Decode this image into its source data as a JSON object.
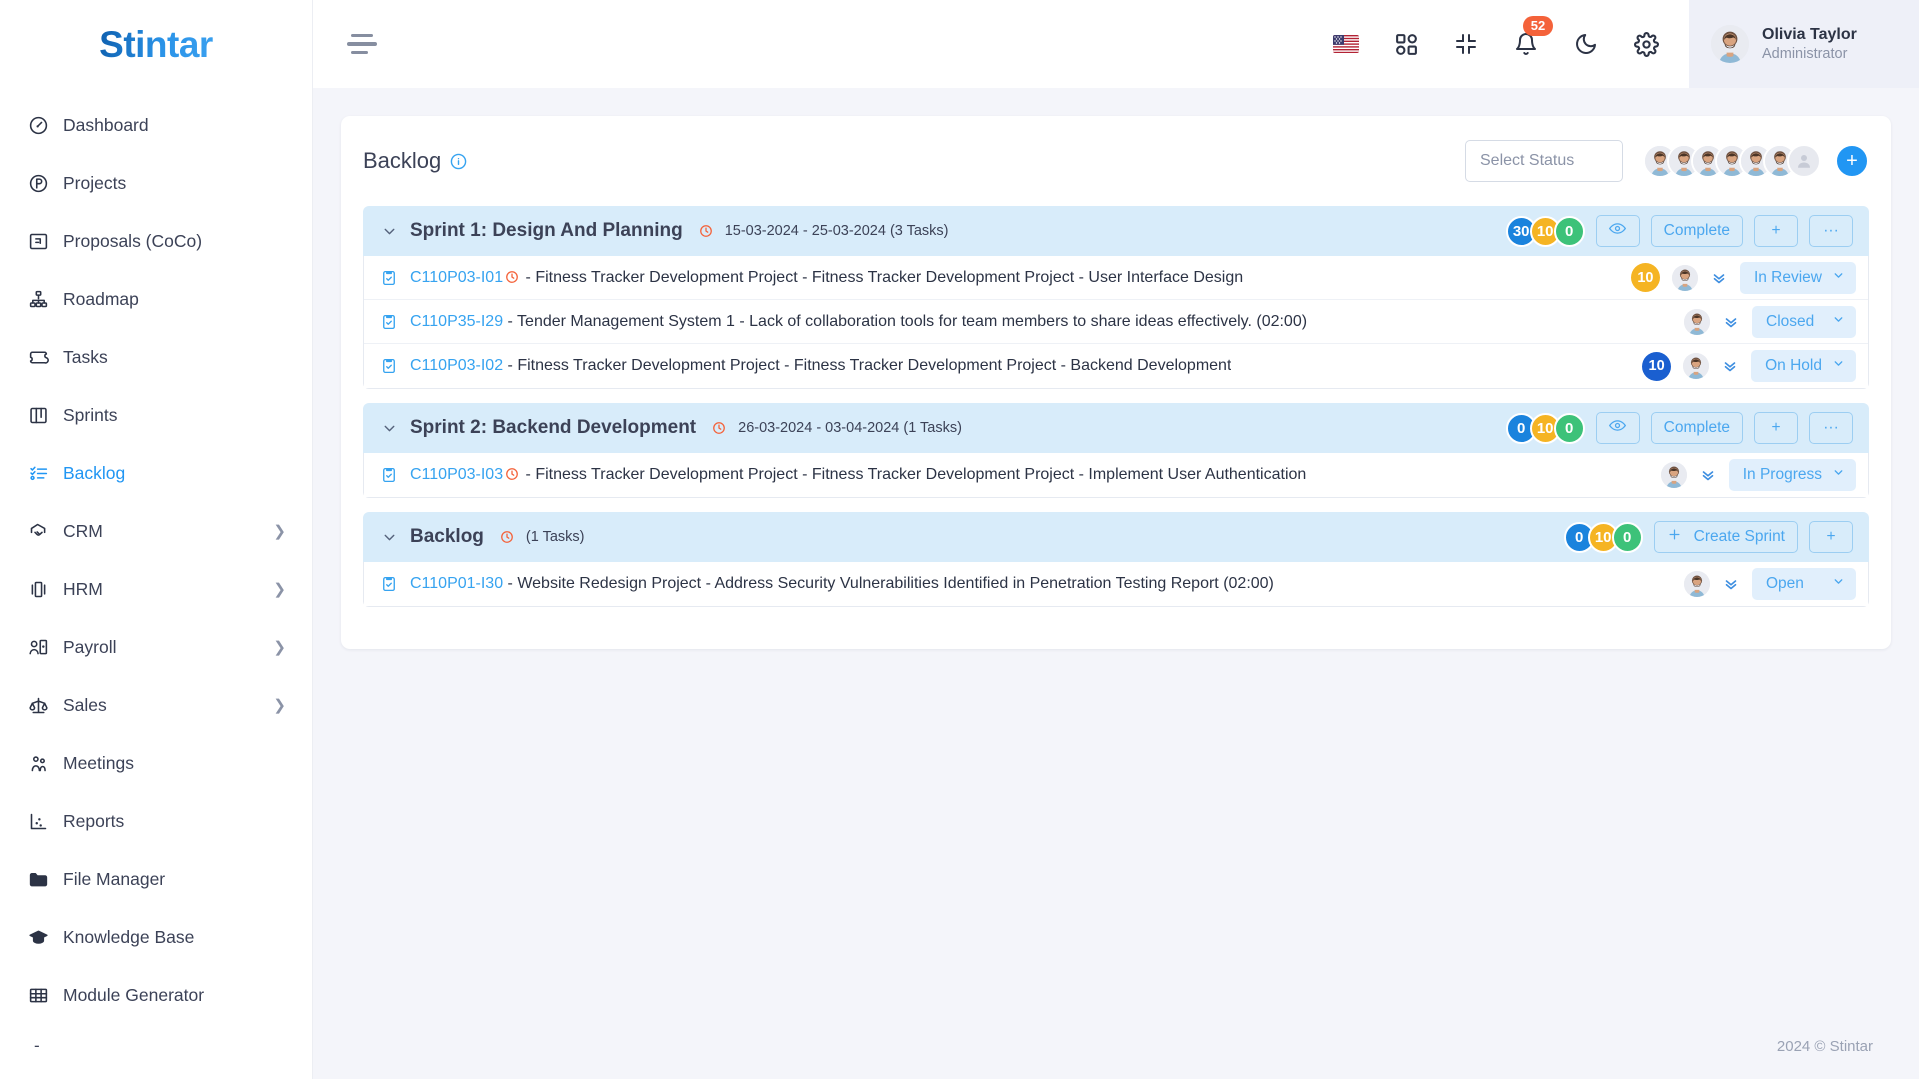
{
  "brand": {
    "name": "Stintar"
  },
  "sidebar": {
    "items": [
      {
        "label": "Dashboard",
        "icon": "gauge-icon",
        "active": false,
        "expandable": false
      },
      {
        "label": "Projects",
        "icon": "project-circle-icon",
        "active": false,
        "expandable": false
      },
      {
        "label": "Proposals (CoCo)",
        "icon": "proposal-icon",
        "active": false,
        "expandable": false
      },
      {
        "label": "Roadmap",
        "icon": "roadmap-icon",
        "active": false,
        "expandable": false
      },
      {
        "label": "Tasks",
        "icon": "ticket-icon",
        "active": false,
        "expandable": false
      },
      {
        "label": "Sprints",
        "icon": "board-icon",
        "active": false,
        "expandable": false
      },
      {
        "label": "Backlog",
        "icon": "backlog-icon",
        "active": true,
        "expandable": false
      },
      {
        "label": "CRM",
        "icon": "handshake-icon",
        "active": false,
        "expandable": true
      },
      {
        "label": "HRM",
        "icon": "hrm-icon",
        "active": false,
        "expandable": true
      },
      {
        "label": "Payroll",
        "icon": "payroll-icon",
        "active": false,
        "expandable": true
      },
      {
        "label": "Sales",
        "icon": "scales-icon",
        "active": false,
        "expandable": true
      },
      {
        "label": "Meetings",
        "icon": "people-icon",
        "active": false,
        "expandable": false
      },
      {
        "label": "Reports",
        "icon": "reports-icon",
        "active": false,
        "expandable": false
      },
      {
        "label": "File Manager",
        "icon": "folder-icon",
        "active": false,
        "expandable": false
      },
      {
        "label": "Knowledge Base",
        "icon": "graduation-icon",
        "active": false,
        "expandable": false
      },
      {
        "label": "Module Generator",
        "icon": "grid-table-icon",
        "active": false,
        "expandable": false
      }
    ],
    "tail_label": "-"
  },
  "topbar": {
    "menu_icon": "hamburger-icon",
    "icons": [
      {
        "name": "language-flag-us",
        "label": ""
      },
      {
        "name": "apps-grid-icon",
        "label": ""
      },
      {
        "name": "fullscreen-collapse-icon",
        "label": ""
      },
      {
        "name": "notification-bell-icon",
        "label": ""
      },
      {
        "name": "dark-mode-moon-icon",
        "label": ""
      },
      {
        "name": "settings-gear-icon",
        "label": ""
      }
    ],
    "notification_count": "52",
    "user": {
      "name": "Olivia Taylor",
      "role": "Administrator"
    }
  },
  "page": {
    "title": "Backlog",
    "info_icon": "info-icon",
    "status_filter_placeholder": "Select Status",
    "member_avatar_count": 6,
    "add_member_label": "+"
  },
  "groups": [
    {
      "title": "Sprint 1: Design And Planning",
      "dates": "15-03-2024 - 25-03-2024",
      "task_count": "(3 Tasks)",
      "meta": "15-03-2024 - 25-03-2024 (3 Tasks)",
      "pills": [
        {
          "value": "30",
          "color": "#1a83dd"
        },
        {
          "value": "10",
          "color": "#f5b423"
        },
        {
          "value": "0",
          "color": "#3dc279"
        }
      ],
      "actions": {
        "eye": "eye-icon",
        "complete": "Complete",
        "add": "+",
        "more": "···"
      },
      "type": "sprint",
      "tasks": [
        {
          "key": "C110P03-I01",
          "has_clock": true,
          "text": " - Fitness Tracker Development Project - Fitness Tracker Development Project - User Interface Design",
          "pill": {
            "value": "10",
            "color": "#f5b423"
          },
          "status": "In Review"
        },
        {
          "key": "C110P35-I29",
          "has_clock": false,
          "text": " - Tender Management System 1 - Lack of collaboration tools for team members to share ideas effectively. (02:00)",
          "pill": null,
          "status": "Closed"
        },
        {
          "key": "C110P03-I02",
          "has_clock": false,
          "text": " - Fitness Tracker Development Project - Fitness Tracker Development Project - Backend Development",
          "pill": {
            "value": "10",
            "color": "#1a5fd0"
          },
          "status": "On Hold"
        }
      ]
    },
    {
      "title": "Sprint 2: Backend Development",
      "dates": "26-03-2024 - 03-04-2024",
      "task_count": "(1 Tasks)",
      "meta": "26-03-2024 - 03-04-2024 (1 Tasks)",
      "pills": [
        {
          "value": "0",
          "color": "#1a83dd"
        },
        {
          "value": "10",
          "color": "#f5b423"
        },
        {
          "value": "0",
          "color": "#3dc279"
        }
      ],
      "actions": {
        "eye": "eye-icon",
        "complete": "Complete",
        "add": "+",
        "more": "···"
      },
      "type": "sprint",
      "tasks": [
        {
          "key": "C110P03-I03",
          "has_clock": true,
          "text": " - Fitness Tracker Development Project - Fitness Tracker Development Project - Implement User Authentication",
          "pill": null,
          "status": "In Progress"
        }
      ]
    },
    {
      "title": "Backlog",
      "dates": "",
      "task_count": "(1 Tasks)",
      "meta": "(1 Tasks)",
      "pills": [
        {
          "value": "0",
          "color": "#1a83dd"
        },
        {
          "value": "10",
          "color": "#f5b423"
        },
        {
          "value": "0",
          "color": "#3dc279"
        }
      ],
      "actions": {
        "create_sprint": "Create Sprint",
        "add": "+"
      },
      "type": "backlog",
      "tasks": [
        {
          "key": "C110P01-I30",
          "has_clock": false,
          "text": " - Website Redesign Project - Address Security Vulnerabilities Identified in Penetration Testing Report (02:00)",
          "pill": null,
          "status": "Open"
        }
      ]
    }
  ],
  "footer": {
    "copyright": "2024 © Stintar"
  },
  "colors": {
    "accent": "#2196f3",
    "group_header_bg": "#d8ecfa",
    "badge_red": "#f4623a",
    "pill_blue": "#1a83dd",
    "pill_amber": "#f5b423",
    "pill_green": "#3dc279"
  }
}
